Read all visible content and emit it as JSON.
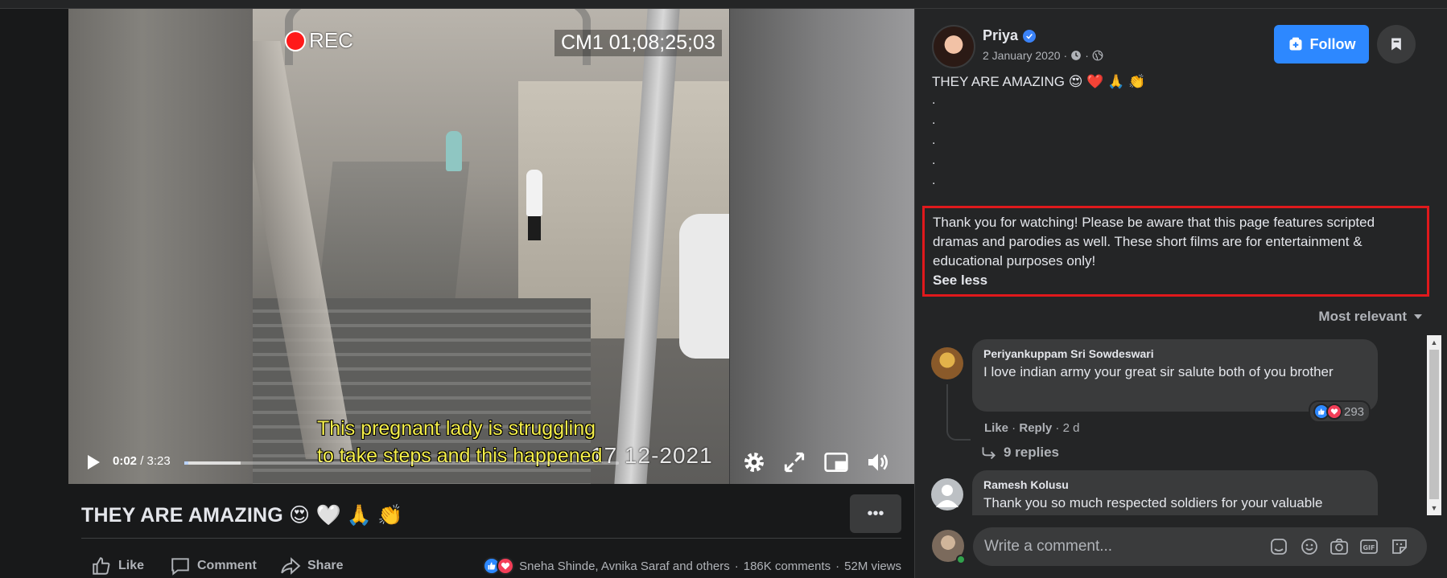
{
  "video": {
    "rec_label": "REC",
    "cam_label": "CM1 01;08;25;03",
    "subtitle_line1": "This pregnant lady is struggling",
    "subtitle_line2": "to take steps and this happened",
    "timestamp_overlay": "17 12-2021",
    "current_time": "0:02",
    "duration": " / 3:23",
    "progress_fraction": 0.01,
    "buffered_fraction": 0.13
  },
  "post": {
    "title": "THEY ARE AMAZING 😍 🤍 🙏 👏",
    "author": "Priya",
    "date": "2 January 2020",
    "meta_sep": "·",
    "follow_label": "Follow",
    "body_first_line": "THEY ARE AMAZING 😍 ❤️ 🙏 👏",
    "body_dots": [
      ".",
      ".",
      ".",
      ".",
      "."
    ],
    "disclaimer": "Thank you for watching! Please be aware that this page features scripted dramas and parodies as well. These short films are for entertainment & educational purposes only!",
    "see_less": "See less"
  },
  "actions": {
    "like": "Like",
    "comment": "Comment",
    "share": "Share",
    "reactors": "Sneha Shinde, Avnika Saraf and others",
    "comments_count": "186K comments",
    "views": "52M views",
    "sep": "·"
  },
  "comments_section": {
    "sort_label": "Most relevant",
    "items": [
      {
        "name": "Periyankuppam Sri Sowdeswari",
        "text": "I love indian army your great sir salute both of you brother",
        "like": "Like",
        "reply": "Reply",
        "age": "2 d",
        "reactions": "293",
        "replies": "9 replies"
      },
      {
        "name": "Ramesh Kolusu",
        "text": "Thank you so much respected soldiers for your valuable"
      }
    ],
    "composer_placeholder": "Write a comment..."
  },
  "colors": {
    "accent": "#2d88ff",
    "highlight_border": "#e0191c",
    "subtitle": "#f5ef4b"
  },
  "icons": [
    "play-icon",
    "settings-icon",
    "fullscreen-icon",
    "pip-icon",
    "volume-icon",
    "like-icon",
    "comment-icon",
    "share-icon",
    "verified-icon",
    "clock-icon",
    "globe-icon",
    "follow-icon",
    "bookmark-icon",
    "caret-down-icon",
    "reply-arrow-icon",
    "sticker-icon",
    "emoji-icon",
    "camera-icon",
    "gif-icon",
    "avatar-sticker-icon"
  ]
}
